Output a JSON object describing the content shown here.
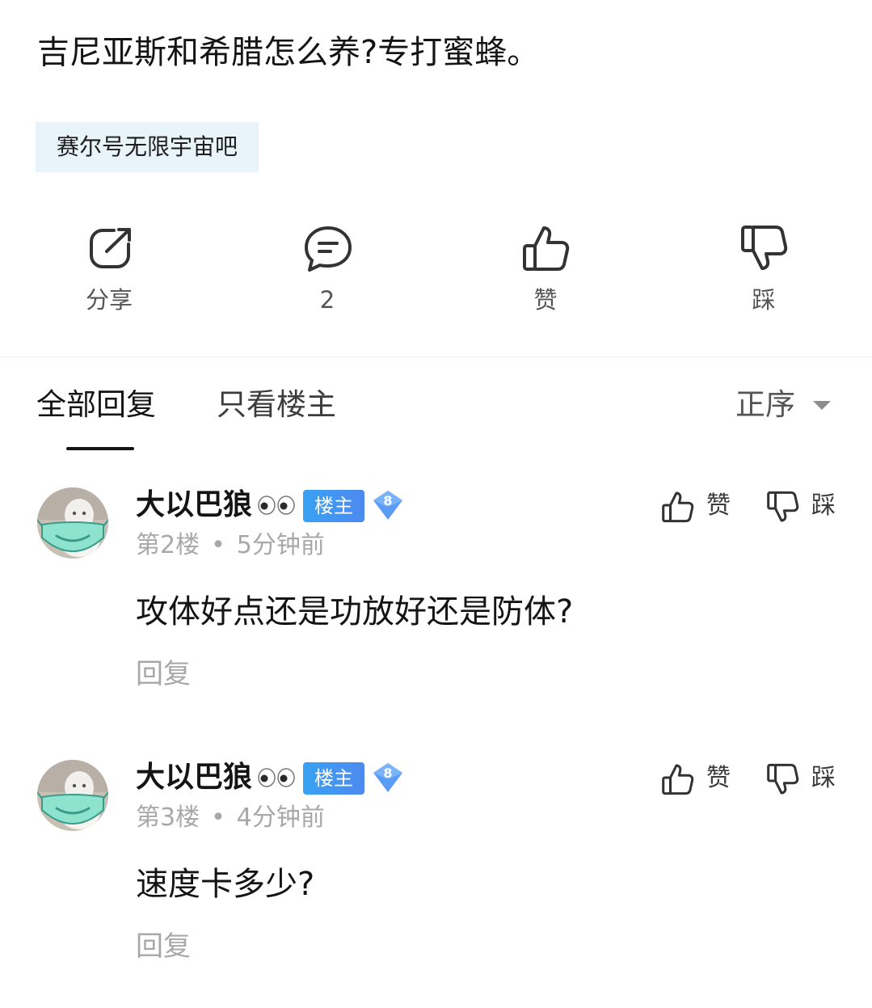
{
  "post": {
    "title": "吉尼亚斯和希腊怎么养?专打蜜蜂。",
    "forum_tag": "赛尔号无限宇宙吧"
  },
  "actions": {
    "share_label": "分享",
    "comment_count": "2",
    "like_label": "赞",
    "dislike_label": "踩",
    "icons": [
      "share-icon",
      "comment-icon",
      "thumbs-up-icon",
      "thumbs-down-icon"
    ]
  },
  "tabs": {
    "all_replies": "全部回复",
    "owner_only": "只看楼主",
    "sort_label": "正序"
  },
  "replies": [
    {
      "username": "大以巴狼",
      "owner_badge": "楼主",
      "level": "8",
      "floor": "第2楼",
      "time": "5分钟前",
      "content": "攻体好点还是功放好还是防体?",
      "reply_label": "回复",
      "like_label": "赞",
      "dislike_label": "踩"
    },
    {
      "username": "大以巴狼",
      "owner_badge": "楼主",
      "level": "8",
      "floor": "第3楼",
      "time": "4分钟前",
      "content": "速度卡多少?",
      "reply_label": "回复",
      "like_label": "赞",
      "dislike_label": "踩"
    }
  ],
  "colors": {
    "tag_background": "#e8f3fa",
    "owner_badge": "#39a2f2",
    "level_badge": "#5b9cf6",
    "muted_text": "#a8a8a8"
  }
}
